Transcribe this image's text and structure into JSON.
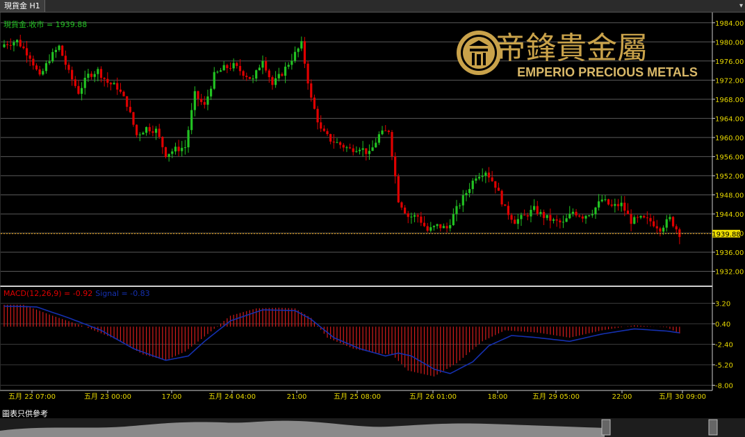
{
  "window": {
    "tab_title": "現貨金 H1"
  },
  "price_panel": {
    "label": "現貨金.收市 = 1939.88",
    "last_price_label": "1939.88"
  },
  "macd_panel": {
    "label_macd": "MACD(12,26,9) = -0.92",
    "label_signal": "Signal = -0.83"
  },
  "logo": {
    "chinese": "帝鋒貴金屬",
    "english": "EMPERIO PRECIOUS METALS"
  },
  "footer": {
    "note": "圖表只供參考"
  },
  "colors": {
    "up": "#22c222",
    "down": "#e00000",
    "signal": "#1530b0",
    "histogram": "#d41c1c",
    "grid": "#5a5a5a",
    "logo_gold": "#c9a24a",
    "axis_text": "#e8d800",
    "price_line": "#f0a000"
  },
  "chart_data": {
    "type": "candlestick",
    "instrument": "現貨金",
    "timeframe": "H1",
    "last_close": 1939.88,
    "price_axis": {
      "ticks": [
        1932,
        1936,
        1940,
        1944,
        1948,
        1952,
        1956,
        1960,
        1964,
        1968,
        1972,
        1976,
        1980,
        1984
      ],
      "tick_labels": [
        "1932.00",
        "1936.00",
        "1940.00",
        "1944.00",
        "1948.00",
        "1952.00",
        "1956.00",
        "1960.00",
        "1964.00",
        "1968.00",
        "1972.00",
        "1976.00",
        "1980.00",
        "1984.00"
      ]
    },
    "macd_axis": {
      "ticks": [
        3.2,
        0.4,
        -2.4,
        -5.2,
        -8.0
      ],
      "tick_labels": [
        "3.20",
        "0.40",
        "-2.40",
        "-5.20",
        "-8.00"
      ]
    },
    "time_labels": [
      "五月 22 07:00",
      "五月 23 00:00",
      "17:00",
      "五月 24 04:00",
      "21:00",
      "五月 25 08:00",
      "五月 26 01:00",
      "18:00",
      "五月 29 05:00",
      "22:00",
      "五月 30 09:00"
    ],
    "close_path": [
      [
        0,
        1979.5
      ],
      [
        4,
        1980.2
      ],
      [
        8,
        1977.0
      ],
      [
        11,
        1972.5
      ],
      [
        14,
        1976.5
      ],
      [
        17,
        1979.0
      ],
      [
        20,
        1973.5
      ],
      [
        23,
        1969.5
      ],
      [
        26,
        1973.0
      ],
      [
        29,
        1974.0
      ],
      [
        32,
        1971.5
      ],
      [
        35,
        1970.5
      ],
      [
        38,
        1967.0
      ],
      [
        41,
        1960.5
      ],
      [
        44,
        1962.0
      ],
      [
        47,
        1961.5
      ],
      [
        50,
        1956.5
      ],
      [
        53,
        1957.5
      ],
      [
        56,
        1958.0
      ],
      [
        59,
        1969.0
      ],
      [
        62,
        1966.5
      ],
      [
        65,
        1973.0
      ],
      [
        68,
        1974.5
      ],
      [
        71,
        1975.0
      ],
      [
        74,
        1973.5
      ],
      [
        77,
        1972.0
      ],
      [
        80,
        1976.5
      ],
      [
        83,
        1971.0
      ],
      [
        86,
        1973.5
      ],
      [
        89,
        1976.5
      ],
      [
        92,
        1979.5
      ],
      [
        95,
        1968.0
      ],
      [
        98,
        1961.5
      ],
      [
        101,
        1959.5
      ],
      [
        104,
        1958.5
      ],
      [
        107,
        1957.5
      ],
      [
        110,
        1958.0
      ],
      [
        113,
        1956.5
      ],
      [
        116,
        1960.5
      ],
      [
        119,
        1961.5
      ],
      [
        122,
        1947.0
      ],
      [
        125,
        1943.5
      ],
      [
        128,
        1943.5
      ],
      [
        131,
        1940.5
      ],
      [
        134,
        1941.5
      ],
      [
        137,
        1941.0
      ],
      [
        140,
        1945.0
      ],
      [
        143,
        1948.5
      ],
      [
        146,
        1952.0
      ],
      [
        149,
        1953.0
      ],
      [
        152,
        1950.0
      ],
      [
        155,
        1945.0
      ],
      [
        158,
        1942.5
      ],
      [
        161,
        1943.5
      ],
      [
        164,
        1945.0
      ],
      [
        167,
        1943.5
      ],
      [
        170,
        1942.5
      ],
      [
        173,
        1942.0
      ],
      [
        176,
        1944.5
      ],
      [
        179,
        1943.5
      ],
      [
        182,
        1944.5
      ],
      [
        185,
        1947.0
      ],
      [
        188,
        1945.5
      ],
      [
        191,
        1946.0
      ],
      [
        194,
        1942.5
      ],
      [
        197,
        1943.0
      ],
      [
        200,
        1942.5
      ],
      [
        203,
        1941.0
      ],
      [
        206,
        1943.0
      ],
      [
        209,
        1939.88
      ]
    ],
    "macd_histogram_path": [
      [
        0,
        3.0
      ],
      [
        6,
        3.0
      ],
      [
        15,
        1.5
      ],
      [
        25,
        0.0
      ],
      [
        35,
        -1.8
      ],
      [
        43,
        -3.8
      ],
      [
        50,
        -4.6
      ],
      [
        56,
        -3.4
      ],
      [
        63,
        -1.0
      ],
      [
        70,
        1.5
      ],
      [
        78,
        2.5
      ],
      [
        85,
        2.6
      ],
      [
        90,
        2.5
      ],
      [
        95,
        1.2
      ],
      [
        100,
        -1.5
      ],
      [
        108,
        -3.0
      ],
      [
        115,
        -3.6
      ],
      [
        120,
        -3.8
      ],
      [
        125,
        -6.0
      ],
      [
        133,
        -6.8
      ],
      [
        140,
        -5.0
      ],
      [
        148,
        -2.0
      ],
      [
        155,
        -0.5
      ],
      [
        165,
        -0.8
      ],
      [
        175,
        -1.5
      ],
      [
        185,
        -0.5
      ],
      [
        195,
        0.2
      ],
      [
        205,
        -0.1
      ],
      [
        209,
        -0.92
      ]
    ],
    "signal_path": [
      [
        0,
        2.8
      ],
      [
        10,
        2.7
      ],
      [
        20,
        1.2
      ],
      [
        30,
        -0.5
      ],
      [
        40,
        -3.0
      ],
      [
        50,
        -4.6
      ],
      [
        57,
        -4.0
      ],
      [
        62,
        -2.0
      ],
      [
        70,
        0.8
      ],
      [
        80,
        2.3
      ],
      [
        90,
        2.2
      ],
      [
        95,
        1.0
      ],
      [
        102,
        -1.5
      ],
      [
        110,
        -3.0
      ],
      [
        118,
        -4.0
      ],
      [
        122,
        -3.6
      ],
      [
        126,
        -4.0
      ],
      [
        133,
        -5.8
      ],
      [
        138,
        -6.4
      ],
      [
        145,
        -4.8
      ],
      [
        150,
        -2.6
      ],
      [
        157,
        -1.2
      ],
      [
        165,
        -1.5
      ],
      [
        175,
        -2.0
      ],
      [
        185,
        -1.0
      ],
      [
        195,
        -0.3
      ],
      [
        205,
        -0.6
      ],
      [
        209,
        -0.83
      ]
    ],
    "sample_bars": 210
  }
}
